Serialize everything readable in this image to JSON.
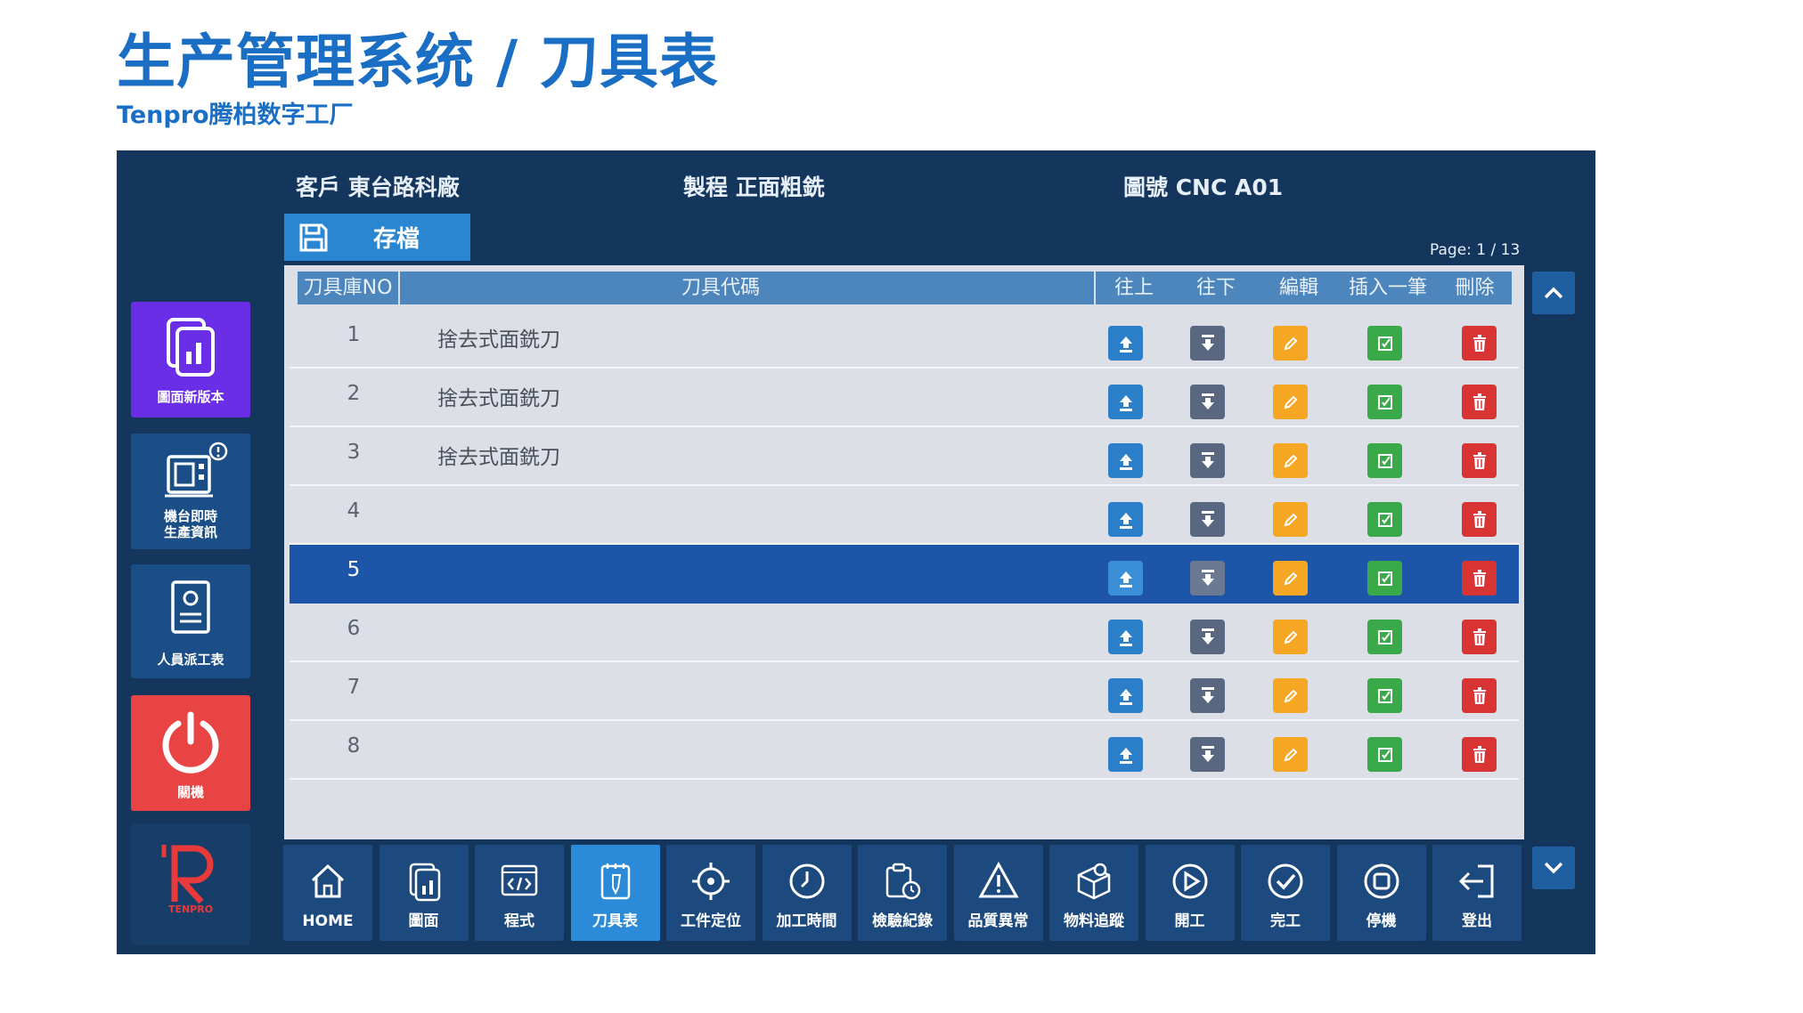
{
  "page": {
    "title": "生产管理系统 / 刀具表",
    "subtitle": "Tenpro腾柏数字工厂"
  },
  "header": {
    "customer": "客戶 東台路科廠",
    "process": "製程 正面粗銑",
    "drawing": "圖號 CNC A01",
    "save_label": "存檔",
    "page_indicator": "Page: 1 / 13"
  },
  "sidebar": {
    "items": [
      {
        "label": "圖面新版本",
        "icon": "drawing-version-icon",
        "color": "#6a2ee6"
      },
      {
        "label_line1": "機台即時",
        "label_line2": "生產資訊",
        "icon": "machine-info-icon",
        "badge": "!"
      },
      {
        "label": "人員派工表",
        "icon": "dispatch-sheet-icon"
      },
      {
        "label": "關機",
        "icon": "power-icon",
        "color": "#e84444"
      },
      {
        "label": "TENPRO",
        "icon": "tenpro-logo"
      }
    ]
  },
  "table": {
    "columns": [
      "刀具庫NO",
      "刀具代碼",
      "往上",
      "往下",
      "編輯",
      "插入一筆",
      "刪除"
    ],
    "rows": [
      {
        "no": "1",
        "name": "捨去式面銑刀",
        "selected": false
      },
      {
        "no": "2",
        "name": "捨去式面銑刀",
        "selected": false
      },
      {
        "no": "3",
        "name": "捨去式面銑刀",
        "selected": false
      },
      {
        "no": "4",
        "name": "",
        "selected": false
      },
      {
        "no": "5",
        "name": "",
        "selected": true
      },
      {
        "no": "6",
        "name": "",
        "selected": false
      },
      {
        "no": "7",
        "name": "",
        "selected": false
      },
      {
        "no": "8",
        "name": "",
        "selected": false
      }
    ],
    "action_colors": {
      "up": "#2b7fc9",
      "down": "#5a6780",
      "edit": "#f5a623",
      "insert": "#39a94a",
      "delete": "#d83434"
    }
  },
  "toolbar": {
    "items": [
      {
        "label": "HOME",
        "icon": "home-icon"
      },
      {
        "label": "圖面",
        "icon": "drawing-icon"
      },
      {
        "label": "程式",
        "icon": "code-icon"
      },
      {
        "label": "刀具表",
        "icon": "tool-list-icon",
        "active": true
      },
      {
        "label": "工件定位",
        "icon": "target-icon"
      },
      {
        "label": "加工時間",
        "icon": "clock-icon"
      },
      {
        "label": "檢驗紀錄",
        "icon": "inspection-icon"
      },
      {
        "label": "品質異常",
        "icon": "warning-icon"
      },
      {
        "label": "物料追蹤",
        "icon": "material-icon"
      },
      {
        "label": "開工",
        "icon": "play-icon"
      },
      {
        "label": "完工",
        "icon": "check-icon"
      },
      {
        "label": "停機",
        "icon": "stop-icon"
      },
      {
        "label": "登出",
        "icon": "logout-icon"
      }
    ]
  },
  "colors": {
    "title": "#1a6fc4",
    "screen_bg": "#14365c",
    "selected_row": "#1d55a8",
    "toolbar_active": "#2b8bd8"
  }
}
